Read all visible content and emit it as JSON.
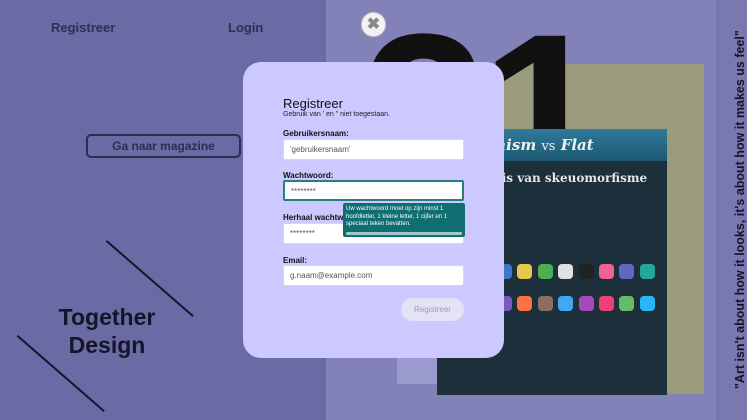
{
  "nav": {
    "register": "Registreer",
    "login": "Login"
  },
  "magazine_button": "Ga naar magazine",
  "together": {
    "line1": "Together",
    "line2": "Design"
  },
  "background": {
    "big_number": "21",
    "article": {
      "title_left": "omorphism",
      "title_vs": "vs",
      "title_right": "Flat",
      "subtitle": "denis van skeuomorfisme"
    }
  },
  "vertical_quote": "\"Art isn't about how it looks, it's about how it makes us feel\"",
  "modal": {
    "close_symbol": "✖",
    "title": "Registreer",
    "hint": "Gebruik van ' en \" niet toegestaan.",
    "username": {
      "label": "Gebruikersnaam:",
      "placeholder": "'gebruikersnaam'"
    },
    "password": {
      "label": "Wachtwoord:",
      "value": "********"
    },
    "password_repeat": {
      "label": "Herhaal wachtwoord:",
      "value": "********"
    },
    "email": {
      "label": "Email:",
      "placeholder": "g.naam@example.com"
    },
    "tooltip": "Uw wachtwoord moet op zijn minst 1 hoofdletter, 1 kleine letter, 1 cijfer en 1 speciaal teken bevatten.",
    "submit": "Registreer"
  }
}
